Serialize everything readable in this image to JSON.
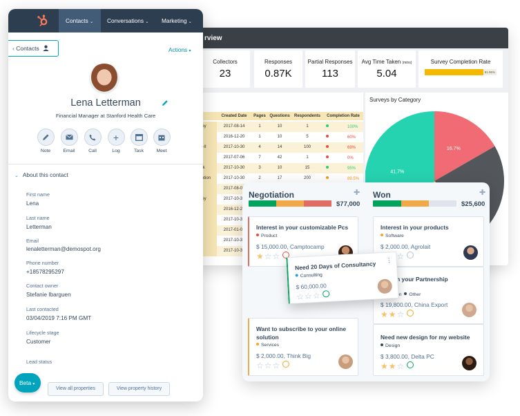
{
  "survey": {
    "header_title": "rview",
    "kpis": [
      {
        "label": "Collectors",
        "value": "23"
      },
      {
        "label": "Responses",
        "value": "0.87K"
      },
      {
        "label": "Partial Responses",
        "value": "113"
      },
      {
        "label": "Avg Time Taken",
        "unit": "(mins)",
        "value": "5.04"
      },
      {
        "label": "Survey Completion Rate",
        "value": "",
        "progress_pct": 81.95,
        "progress_text": "81.95%"
      }
    ],
    "table": {
      "headers": [
        "Created Date",
        "Pages",
        "Questions",
        "Respondents",
        "Completion Rate"
      ],
      "rows": [
        {
          "name": "urvey",
          "date": "2017-08-14",
          "pages": "1",
          "questions": "10",
          "respondents": "1",
          "rate": "100%",
          "color": "#2ecc71"
        },
        {
          "name": "",
          "date": "2016-12-20",
          "pages": "1",
          "questions": "10",
          "respondents": "5",
          "rate": "60%",
          "color": "#e74c3c"
        },
        {
          "name": "vey-II",
          "date": "2017-10-30",
          "pages": "4",
          "questions": "14",
          "respondents": "100",
          "rate": "69%",
          "color": "#e74c3c"
        },
        {
          "name": "",
          "date": "2017-07-06",
          "pages": "7",
          "questions": "42",
          "respondents": "1",
          "rate": "0%",
          "color": "#e74c3c"
        },
        {
          "name": "back",
          "date": "2017-10-30",
          "pages": "3",
          "questions": "10",
          "respondents": "15",
          "rate": "95%",
          "color": "#2ecc71"
        },
        {
          "name": "aluation",
          "date": "2017-10-30",
          "pages": "2",
          "questions": "17",
          "respondents": "200",
          "rate": "89.5%",
          "color": "#f39c12"
        },
        {
          "name": "",
          "date": "2017-08-08",
          "pages": "",
          "questions": "",
          "respondents": "",
          "rate": "",
          "color": ""
        },
        {
          "name": "urvey",
          "date": "2017-10-30",
          "pages": "",
          "questions": "",
          "respondents": "",
          "rate": "",
          "color": ""
        },
        {
          "name": "",
          "date": "2016-12-20",
          "pages": "",
          "questions": "",
          "respondents": "",
          "rate": "",
          "color": ""
        },
        {
          "name": "",
          "date": "2017-10-30",
          "pages": "",
          "questions": "",
          "respondents": "",
          "rate": "",
          "color": ""
        },
        {
          "name": "",
          "date": "2017-01-03",
          "pages": "",
          "questions": "",
          "respondents": "",
          "rate": "",
          "color": ""
        },
        {
          "name": "ck",
          "date": "2017-10-30",
          "pages": "",
          "questions": "",
          "respondents": "",
          "rate": "",
          "color": ""
        },
        {
          "name": "",
          "date": "2017-10-30",
          "pages": "",
          "questions": "",
          "respondents": "",
          "rate": "",
          "color": ""
        }
      ]
    },
    "chart_title": "Surveys by Category"
  },
  "chart_data": {
    "type": "pie",
    "title": "Surveys by Category",
    "slices": [
      {
        "label": "16.7%",
        "value": 16.7,
        "color": "#f06b73"
      },
      {
        "label": "",
        "value": 20.0,
        "color": "#53575c"
      },
      {
        "label": "",
        "value": 21.6,
        "color": "#f5c26b"
      },
      {
        "label": "41.7%",
        "value": 41.7,
        "color": "#26d3b0"
      }
    ]
  },
  "board": {
    "columns": [
      {
        "name": "Negotiation",
        "amount": "$77,000",
        "bar": [
          {
            "w": 40,
            "c": "#00a35c"
          },
          {
            "w": 40,
            "c": "#f0a849"
          },
          {
            "w": 40,
            "c": "#e06b62"
          }
        ]
      },
      {
        "name": "Won",
        "amount": "$25,600",
        "bar": [
          {
            "w": 41,
            "c": "#00a35c"
          },
          {
            "w": 40,
            "c": "#f0a849"
          },
          {
            "w": 40,
            "c": "#dfe3eb"
          }
        ]
      }
    ],
    "cards": [
      {
        "title": "Interest in your customizable Pcs",
        "tag": "Product",
        "tag_color": "#e74c3c",
        "price": "$ 15,000.00, Camptocamp",
        "stars": 1,
        "status": "#e74c3c"
      },
      {
        "title": "Need 20 Days of Consultancy",
        "tag": "Consulting",
        "tag_color": "#2a9fd6",
        "price": "$ 60,000.00",
        "stars": 0,
        "status": "#00a35c"
      },
      {
        "title": "Want to subscribe to your online solution",
        "tag": "Services",
        "tag_color": "#f5a623",
        "price": "$ 2,000.00, Think Big",
        "stars": 0,
        "status": "#f5a623"
      },
      {
        "title": "Interest in your products",
        "tag": "Software",
        "tag_color": "#f5a623",
        "price": "$ 2,000.00, Agrolait",
        "stars": 0,
        "status": "#b5c2d0"
      },
      {
        "title": "ct in your Partnership",
        "title2": "ct",
        "tag": "nation",
        "tag2": "Other",
        "tag_color": "#33475b",
        "price": "$ 19,800.00, China Export",
        "stars": 2,
        "status": "#f5a623"
      },
      {
        "title": "Need new design for my website",
        "tag": "Design",
        "tag_color": "#33475b",
        "price": "$ 3,800.00, Delta PC",
        "stars": 2,
        "status": "#00a35c"
      }
    ]
  },
  "contact": {
    "nav": [
      "Contacts",
      "Conversations",
      "Marketing"
    ],
    "back_label": "Contacts",
    "actions_label": "Actions",
    "name": "Lena Letterman",
    "subtitle": "Financial Manager at Stanford Health Care",
    "activity_buttons": [
      "Note",
      "Email",
      "Call",
      "Log",
      "Task",
      "Meet"
    ],
    "section_title": "About this contact",
    "fields": [
      {
        "label": "First name",
        "value": "Lena"
      },
      {
        "label": "Last name",
        "value": "Letterman"
      },
      {
        "label": "Email",
        "value": "lenaletterman@demospot.org"
      },
      {
        "label": "Phone number",
        "value": "+18578295297"
      },
      {
        "label": "Contact owner",
        "value": "Stefanie Ibarguen"
      },
      {
        "label": "Last contacted",
        "value": "03/04/2019 7:16 PM GMT"
      },
      {
        "label": "Lifecycle stage",
        "value": "Customer"
      },
      {
        "label": "Lead status",
        "value": ""
      }
    ],
    "beta_label": "Beta",
    "view_all_label": "View all properties",
    "view_history_label": "View property history",
    "accent": "#00a4bd"
  }
}
